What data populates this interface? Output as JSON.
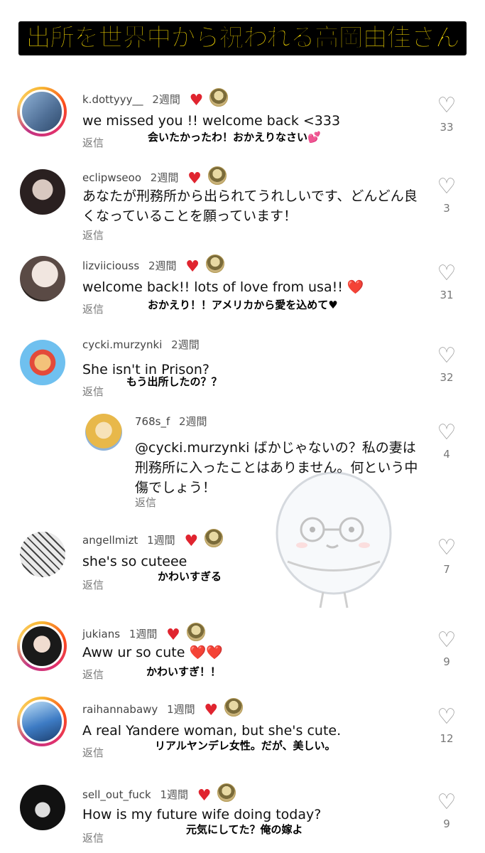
{
  "title": "出所を世界中から祝われる高岡由佳さん",
  "reply_label": "返信",
  "comments": [
    {
      "user": "k.dottyyy__",
      "time": "2週間",
      "text": "we missed you !! welcome back <333",
      "caption": "会いたかったわ！おかえりなさい💕",
      "likes": "33",
      "liked_by_creator": true,
      "ring": true,
      "avatar_color": "#5a7fa8"
    },
    {
      "user": "eclipwseoo",
      "time": "2週間",
      "text": "あなたが刑務所から出られてうれしいです、どんどん良くなっていることを願っています！",
      "caption": "",
      "likes": "3",
      "liked_by_creator": true,
      "ring": false,
      "avatar_color": "#3a3030"
    },
    {
      "user": "lizviiciouss",
      "time": "2週間",
      "text": "welcome back!! lots of love from usa!! ❤️",
      "caption": "おかえり！！アメリカから愛を込めて♥",
      "likes": "31",
      "liked_by_creator": true,
      "ring": false,
      "avatar_color": "#8a6a5a"
    },
    {
      "user": "cycki.murzynki",
      "time": "2週間",
      "text": "She isn't in Prison?",
      "caption": "もう出所したの？？",
      "likes": "32",
      "liked_by_creator": false,
      "ring": false,
      "avatar_color": "#4aa3df"
    },
    {
      "user": "768s_f",
      "time": "2週間",
      "text": "@cycki.murzynki ばかじゃないの？私の妻は刑務所に入ったことはありません。何という中傷でしょう！",
      "caption": "",
      "likes": "4",
      "liked_by_creator": false,
      "ring": false,
      "avatar_color": "#e8c77a",
      "nested": true
    },
    {
      "user": "angellmizt",
      "time": "1週間",
      "text": "she's so cuteee",
      "caption": "かわいすぎる",
      "likes": "7",
      "liked_by_creator": true,
      "ring": false,
      "avatar_color": "#dddddd"
    },
    {
      "user": "jukians",
      "time": "1週間",
      "text": "Aww ur so cute ❤️❤️",
      "caption": "かわいすぎ！！",
      "likes": "9",
      "liked_by_creator": true,
      "ring": true,
      "avatar_color": "#2a2a2a"
    },
    {
      "user": "raihannabawy",
      "time": "1週間",
      "text": "A real Yandere woman, but she's cute.",
      "caption": "リアルヤンデレ女性。だが、美しい。",
      "likes": "12",
      "liked_by_creator": true,
      "ring": true,
      "avatar_color": "#3d7bc4"
    },
    {
      "user": "sell_out_fuck",
      "time": "1週間",
      "text": "How is my future wife doing today?",
      "caption": "元気にしてた？俺の嫁よ",
      "likes": "9",
      "liked_by_creator": true,
      "ring": false,
      "avatar_color": "#111111"
    }
  ],
  "colors": {
    "title_fg": "#ffe000",
    "title_bg": "#000000",
    "heart": "#e0242f"
  },
  "icons": {
    "like": "heart-outline-icon",
    "creator_like": "red-heart-icon"
  }
}
